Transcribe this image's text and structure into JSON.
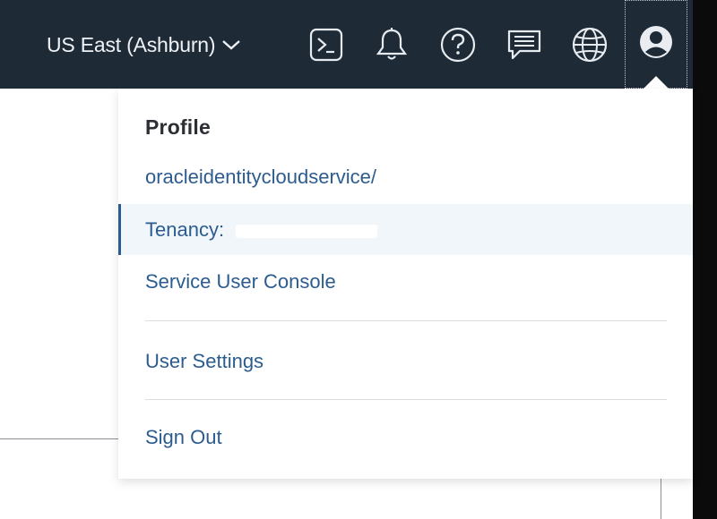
{
  "topbar": {
    "region_label": "US East (Ashburn)",
    "icons": [
      "cloud-shell-icon",
      "bell-icon",
      "help-icon",
      "chat-icon",
      "globe-icon",
      "user-icon"
    ]
  },
  "dropdown": {
    "heading": "Profile",
    "username": "oracleidentitycloudservice/",
    "tenancy_label": "Tenancy: ",
    "service_user_console": "Service User Console",
    "user_settings": "User Settings",
    "sign_out": "Sign Out"
  },
  "colors": {
    "topbar_bg": "#1f2a37",
    "link": "#2c5c8f",
    "highlight_bg": "#f1f6fb"
  }
}
